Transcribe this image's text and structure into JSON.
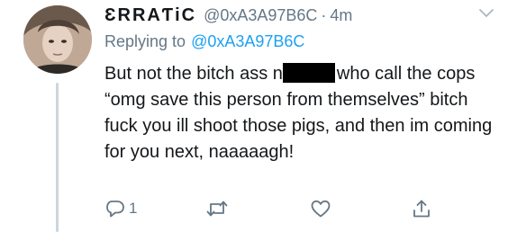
{
  "tweet": {
    "author": {
      "display_name": "ƐRRAƬiC",
      "handle": "@0xA3A97B6C",
      "avatar_icon": "avatar-photo"
    },
    "separator": "·",
    "time": "4m",
    "reply_prefix": "Replying to",
    "reply_to": "@0xA3A97B6C",
    "text_before_censor": "But not the bitch ass n",
    "text_after_censor": "who call the cops “omg save this person from themselves” bitch fuck you ill shoot those pigs, and then im coming for you next, naaaaagh!",
    "actions": {
      "reply_icon": "reply-icon",
      "reply_count": "1",
      "retweet_icon": "retweet-icon",
      "like_icon": "heart-icon",
      "share_icon": "share-icon"
    },
    "colors": {
      "text": "#14171a",
      "secondary": "#657786",
      "link": "#1da1f2",
      "thread_line": "#ccd6dd"
    }
  }
}
